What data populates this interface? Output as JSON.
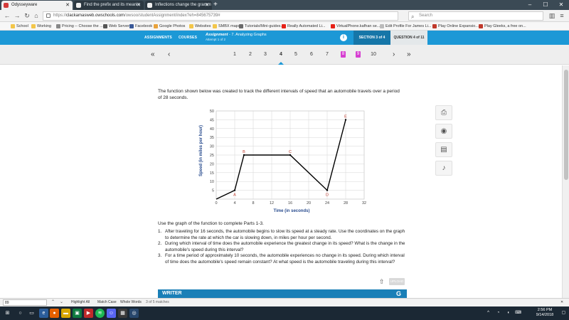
{
  "browser": {
    "tabs": [
      {
        "label": "Odysseyware",
        "active": true
      },
      {
        "label": "Find the prefix and its meanin",
        "active": false
      },
      {
        "label": "Inflections change the gramm",
        "active": false
      }
    ],
    "url_prefix": "https://",
    "url_host": "clackamasweb.owschools.com",
    "url_path": "/owsoo/studentAssignment/index?eh=845675739#",
    "search_placeholder": "Search",
    "bookmarks": [
      "School",
      "Working",
      "Pricing -- Choose the ...",
      "Web Server",
      "Facebook",
      "Google Photos",
      "Websites",
      "SMBX maps",
      "Tutorials/Mini-guides...",
      "Really Automated Li...",
      "VirtualPhone.kafhan se...",
      "Edit Profile For James Li...",
      "Play Online Expansio...",
      "Play Gleeks, a free on..."
    ]
  },
  "app": {
    "assignments": "ASSIGNMENTS",
    "courses": "COURSES",
    "assignment_word": "Assignment",
    "assignment_name": " - 7. Analyzing Graphs",
    "attempt": "Attempt 1 of 2",
    "section": "SECTION 3 of 4",
    "question": "QUESTION 4 of 11"
  },
  "pager": {
    "pages": [
      "1",
      "2",
      "3",
      "4",
      "5",
      "6",
      "7",
      "8",
      "9",
      "10"
    ],
    "flagged_pages": [
      "8",
      "9"
    ],
    "current": "4"
  },
  "content": {
    "intro_line1": "The function shown below was created to track the different intervals of speed that an automobile travels over a period",
    "intro_line2": "of 28 seconds.",
    "parts_intro": "Use the graph of the function to complete Parts 1-3.",
    "parts": [
      {
        "num": "1.",
        "text": "After traveling for 16 seconds, the automobile begins to slow its speed at a steady rate. Use the coordinates on the graph to determine the rate at which the car is slowing down, in miles per hour per second."
      },
      {
        "num": "2.",
        "text": "During which interval of time does the automobile experience the greatest change in its speed? What is the change in the automobile's speed during this interval?"
      },
      {
        "num": "3.",
        "text": "For a time period of approximately 10 seconds, the automobile experiences no change in its speed. During which interval of time does the automobile's speed remain constant? At what speed is the automobile traveling during this interval?"
      }
    ],
    "upload_label": "UPLOAD",
    "writer_label": "WRITER"
  },
  "chart_data": {
    "type": "line",
    "x": [
      0,
      4,
      6,
      16,
      24,
      28
    ],
    "y": [
      0,
      5,
      25,
      25,
      5,
      45
    ],
    "point_labels": [
      "",
      "A",
      "B",
      "C",
      "D",
      "E"
    ],
    "xticks": [
      0,
      4,
      8,
      12,
      16,
      20,
      24,
      28,
      32
    ],
    "yticks": [
      5,
      10,
      15,
      20,
      25,
      30,
      35,
      40,
      45,
      50
    ],
    "xlim": [
      0,
      32
    ],
    "ylim": [
      0,
      50
    ],
    "xlabel": "Time (in seconds)",
    "ylabel": "Speed (in miles per hour)",
    "grid": true,
    "line_color": "#000000",
    "label_color": "#c0392b",
    "axis_label_color": "#2a4d8f"
  },
  "findbar": {
    "query": "89",
    "highlight_all": "Highlight All",
    "match_case": "Match Case",
    "whole_words": "Whole Words",
    "matches": "3 of 5 matches"
  },
  "taskbar": {
    "time": "2:56 PM",
    "date": "9/14/2018"
  },
  "colors": {
    "header_blue": "#1c98d6",
    "flag_magenta": "#d63fd1"
  }
}
